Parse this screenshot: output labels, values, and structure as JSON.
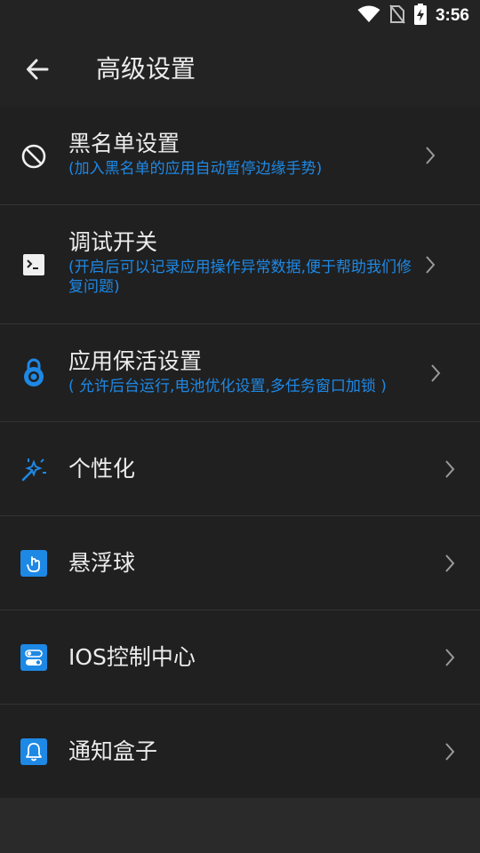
{
  "status_bar": {
    "time": "3:56",
    "icons": [
      "wifi-icon",
      "no-sim-icon",
      "battery-charging-icon"
    ]
  },
  "app_bar": {
    "back_icon": "arrow-left-icon",
    "title": "高级设置"
  },
  "colors": {
    "background": "#2a2a2a",
    "row_background": "#202020",
    "accent_blue": "#1e88e5",
    "text_primary": "#ececec",
    "chevron": "#9a9a9a"
  },
  "settings": [
    {
      "id": "blacklist",
      "title": "黑名单设置",
      "subtitle": "(加入黑名单的应用自动暂停边缘手势)",
      "icon": "block-icon"
    },
    {
      "id": "debug",
      "title": "调试开关",
      "subtitle": "(开启后可以记录应用操作异常数据,便于帮助我们修复问题)",
      "icon": "terminal-icon"
    },
    {
      "id": "keepalive",
      "title": "应用保活设置",
      "subtitle": "( 允许后台运行,电池优化设置,多任务窗口加锁 )",
      "icon": "lock-icon"
    },
    {
      "id": "personalize",
      "title": "个性化",
      "subtitle": "",
      "icon": "magic-wand-icon"
    },
    {
      "id": "floating-ball",
      "title": "悬浮球",
      "subtitle": "",
      "icon": "touch-icon"
    },
    {
      "id": "ios-control",
      "title": "IOS控制中心",
      "subtitle": "",
      "icon": "toggles-icon"
    },
    {
      "id": "notify-box",
      "title": "通知盒子",
      "subtitle": "",
      "icon": "bell-icon"
    }
  ]
}
